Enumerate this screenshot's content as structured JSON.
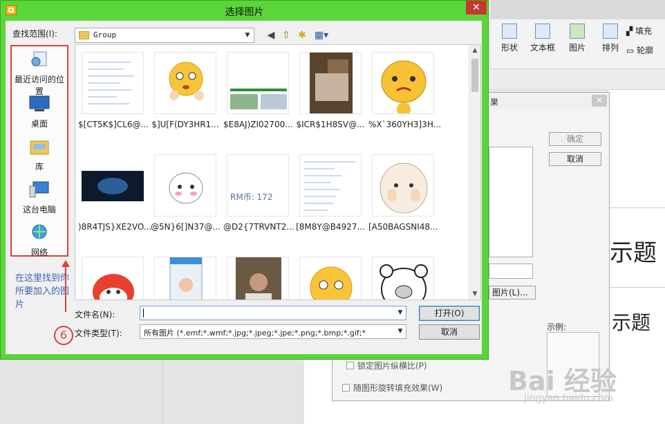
{
  "dialog": {
    "title": "选择图片",
    "close_glyph": "✕",
    "lookin_label": "查找范围(I):",
    "lookin_value": "Group",
    "places": [
      {
        "label": "最近访问的位置",
        "icon": "recent-places-icon"
      },
      {
        "label": "桌面",
        "icon": "desktop-icon"
      },
      {
        "label": "库",
        "icon": "libraries-icon"
      },
      {
        "label": "这台电脑",
        "icon": "this-pc-icon"
      },
      {
        "label": "网络",
        "icon": "network-icon"
      }
    ],
    "files": [
      {
        "name": "$[CT5K$]CL6@..."
      },
      {
        "name": "$]U[F(DY3HR1..."
      },
      {
        "name": "$E8AJ)ZI02700..."
      },
      {
        "name": "$ICR$1H8SV@..."
      },
      {
        "name": "%X`360YH3]3H..."
      },
      {
        "name": ")8R4TJS}XE2VO..."
      },
      {
        "name": "@5N}6[]N37@..."
      },
      {
        "name": "@D2{7TRVNT2..."
      },
      {
        "name": "[8M8Y@B4927..."
      },
      {
        "name": "[A50BAGSNI48..."
      },
      {
        "name": ""
      },
      {
        "name": ""
      },
      {
        "name": ""
      },
      {
        "name": ""
      },
      {
        "name": ""
      }
    ],
    "thumb_caption": "RM币: 172",
    "filename_label": "文件名(N):",
    "filename_value": "",
    "filetype_label": "文件类型(T):",
    "filetype_value": "所有图片 (*.emf;*.wmf;*.jpg;*.jpeg;*.jpe;*.png;*.bmp;*.gif;*",
    "open_label": "打开(O)",
    "cancel_label": "取消"
  },
  "annotation": {
    "note": "在这里找到你所要加入的图片",
    "step": "6"
  },
  "background": {
    "ribbon": [
      "形状",
      "文本框",
      "图片",
      "排列",
      "填充",
      "轮廓"
    ],
    "dialog_ok": "确定",
    "dialog_cancel": "取消",
    "picture_button": "图片(L)...",
    "example_label": "示例:",
    "lock_ratio": "锁定图片纵横比(P)",
    "rotate_fill": "随图形旋转填充效果(W)",
    "heading_big": "示题",
    "heading_small": "示题",
    "title_tail": "果"
  },
  "watermark": {
    "text": "Bai 经验",
    "url": "jingyan.baidu.com"
  },
  "colors": {
    "dialog_frame": "#5bd63a",
    "highlight": "#d9413a",
    "note": "#3a65b6"
  }
}
